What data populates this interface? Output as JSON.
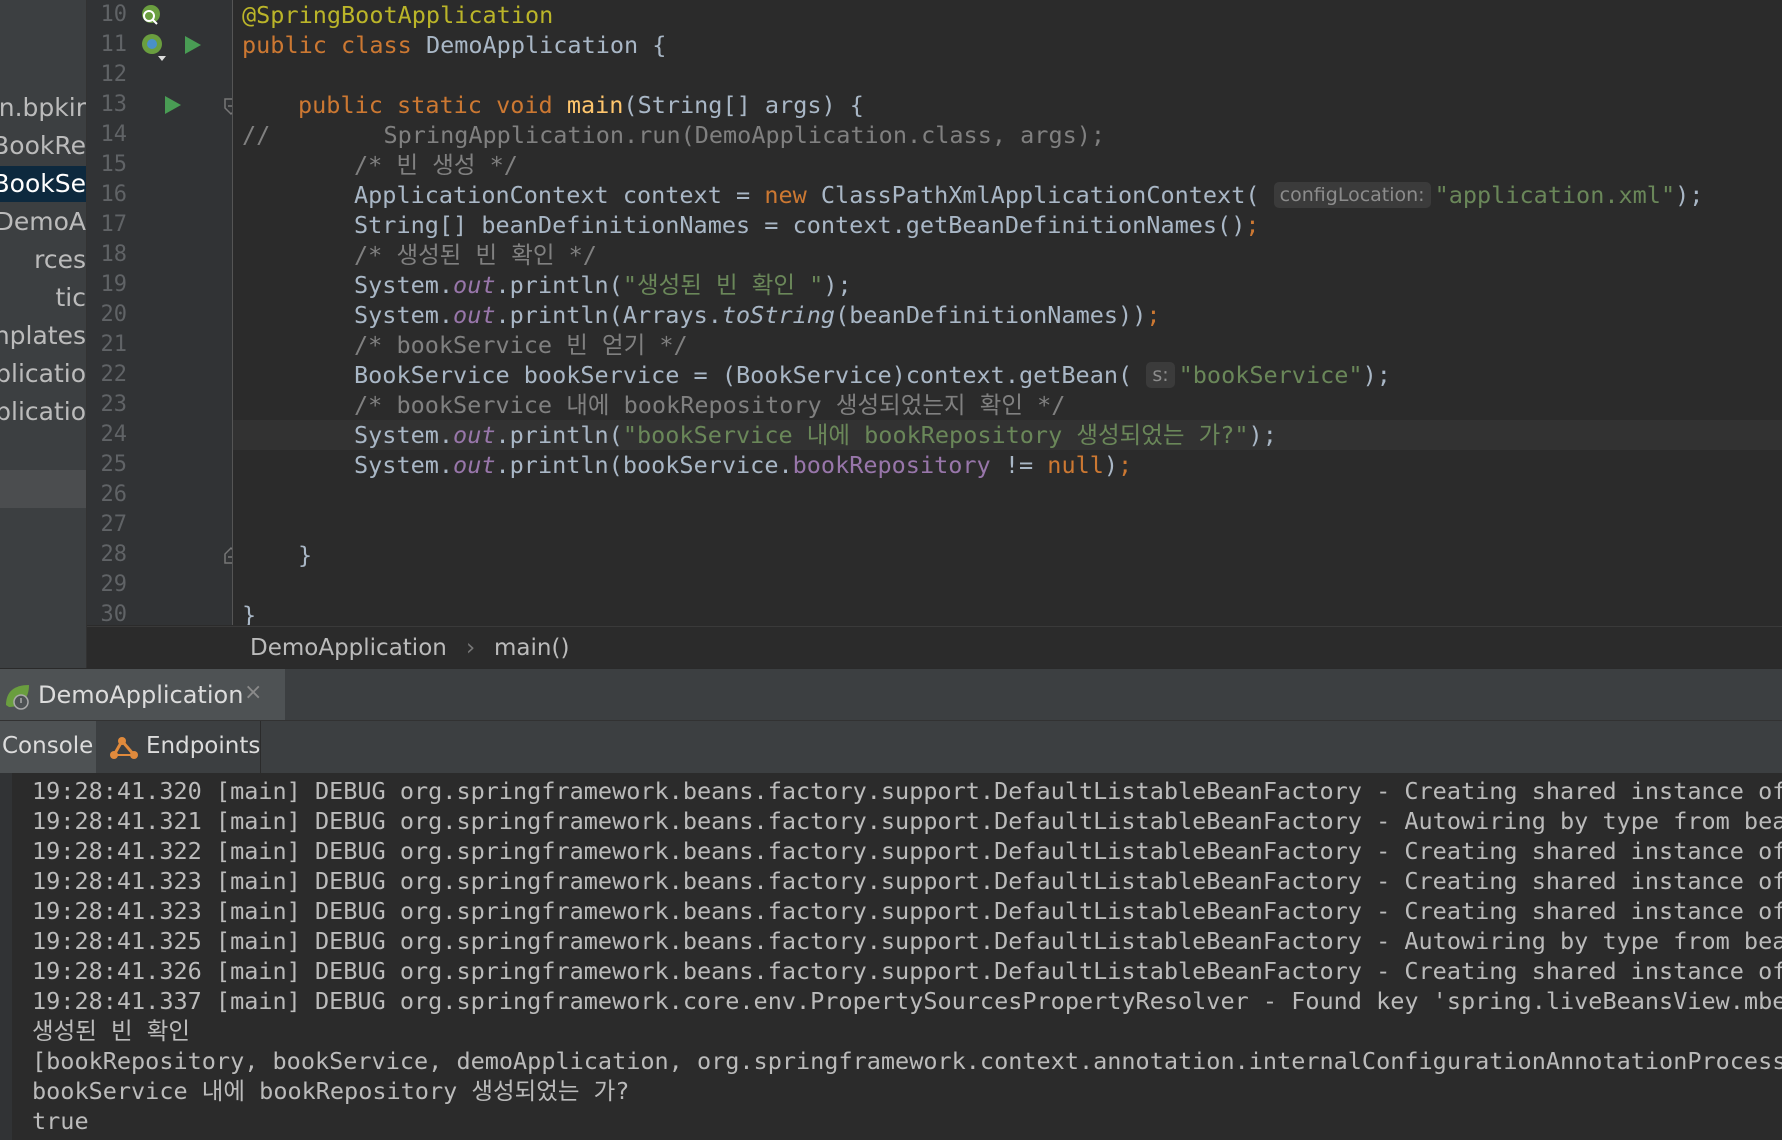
{
  "project_panel": {
    "items": [
      "n.bpkir",
      "BookRe",
      "BookSe",
      "DemoA",
      "rces",
      "tic",
      "nplates",
      "plicatio",
      "plicatio"
    ],
    "selected_index": 2
  },
  "gutter": {
    "line_numbers": [
      "10",
      "11",
      "12",
      "13",
      "14",
      "15",
      "16",
      "17",
      "18",
      "19",
      "20",
      "21",
      "22",
      "23",
      "24",
      "25",
      "26",
      "27",
      "28",
      "29",
      "30"
    ]
  },
  "code": {
    "line10_annotation": "@SpringBootApplication",
    "line11_public": "public ",
    "line11_class": "class ",
    "line11_rest": "DemoApplication {",
    "line13_kw": "public static void ",
    "line13_fn": "main",
    "line13_rest": "(String[] args) {",
    "line14": "//        SpringApplication.run(DemoApplication.class, args);",
    "line15": "/* 빈 생성 */",
    "line16_a": "ApplicationContext context = ",
    "line16_new": "new ",
    "line16_b": "ClassPathXmlApplicationContext(",
    "line16_hint": "configLocation:",
    "line16_str": "\"application.xml\"",
    "line16_end": ");",
    "line17_a": "String[] beanDefinitionNames = context.getBeanDefinitionNames()",
    "line17_semi": ";",
    "line18": "/* 생성된 빈 확인 */",
    "sys": "System.",
    "out": "out",
    "println_open": ".println(",
    "line19_str": "\"생성된 빈 확인 \"",
    "close_semi": ");",
    "line20_a": "Arrays.",
    "line20_tostring": "toString",
    "line20_b": "(beanDefinitionNames))",
    "semi": ";",
    "line21": "/* bookService 빈 얻기 */",
    "line22_a": "BookService bookService = (BookService)context.getBean(",
    "line22_hint": "s:",
    "line22_str": "\"bookService\"",
    "line23": "/* bookService 내에 bookRepository 생성되었는지 확인 */",
    "line24_str": "\"bookService 내에 bookRepository 생성되었는 가?\"",
    "line25_a": "bookService.",
    "line25_field": "bookRepository",
    "line25_op": " != ",
    "line25_null": "null",
    "line25_end": ")",
    "line28": "}",
    "line30": "}"
  },
  "breadcrumb": {
    "class": "DemoApplication",
    "separator": "›",
    "method": "main()"
  },
  "run_panel": {
    "tab_label": "DemoApplication",
    "close_glyph": "×"
  },
  "console_tabs": {
    "console": "Console",
    "endpoints": "Endpoints"
  },
  "console": {
    "lines": [
      "19:28:41.320 [main] DEBUG org.springframework.beans.factory.support.DefaultListableBeanFactory - Creating shared instance of",
      "19:28:41.321 [main] DEBUG org.springframework.beans.factory.support.DefaultListableBeanFactory - Autowiring by type from bean",
      "19:28:41.322 [main] DEBUG org.springframework.beans.factory.support.DefaultListableBeanFactory - Creating shared instance of",
      "19:28:41.323 [main] DEBUG org.springframework.beans.factory.support.DefaultListableBeanFactory - Creating shared instance of",
      "19:28:41.323 [main] DEBUG org.springframework.beans.factory.support.DefaultListableBeanFactory - Creating shared instance of",
      "19:28:41.325 [main] DEBUG org.springframework.beans.factory.support.DefaultListableBeanFactory - Autowiring by type from bean",
      "19:28:41.326 [main] DEBUG org.springframework.beans.factory.support.DefaultListableBeanFactory - Creating shared instance of",
      "19:28:41.337 [main] DEBUG org.springframework.core.env.PropertySourcesPropertyResolver - Found key 'spring.liveBeansView.mbea",
      "생성된 빈 확인",
      "[bookRepository, bookService, demoApplication, org.springframework.context.annotation.internalConfigurationAnnotationProcesso",
      "bookService 내에 bookRepository 생성되었는 가?",
      "true"
    ]
  },
  "colors": {
    "keyword": "#cc7832",
    "annotation": "#bbb529",
    "function": "#ffc66d",
    "string": "#6a8759",
    "comment": "#808080",
    "field": "#9876aa",
    "text": "#a9b7c6",
    "background": "#2b2b2b"
  },
  "icons": [
    "spring-bean-icon",
    "spring-run-icon",
    "run-arrow-icon",
    "fold-icon",
    "lightbulb-icon",
    "spring-boot-icon",
    "endpoints-icon",
    "close-icon"
  ]
}
